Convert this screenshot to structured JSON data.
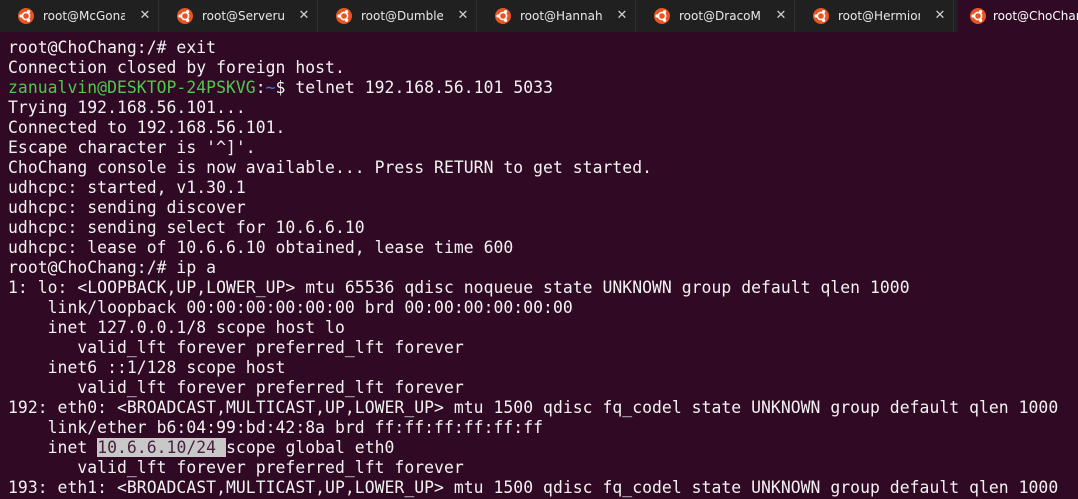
{
  "tabs": [
    {
      "title": "root@McGonag",
      "active": false
    },
    {
      "title": "root@Serverus!",
      "active": false
    },
    {
      "title": "root@Dumbled",
      "active": false
    },
    {
      "title": "root@HannahA",
      "active": false
    },
    {
      "title": "root@DracoMa",
      "active": false
    },
    {
      "title": "root@Hermionе",
      "active": false
    },
    {
      "title": "root@ChoChan",
      "active": true
    }
  ],
  "tab_close_glyph": "✕",
  "terminal": {
    "lines": [
      "root@ChoChang:/# exit",
      "Connection closed by foreign host.",
      {
        "user": "zanualvin@DESKTOP-24PSKVG",
        "sep": ":",
        "path": "~",
        "rest": "$ telnet 192.168.56.101 5033"
      },
      "Trying 192.168.56.101...",
      "Connected to 192.168.56.101.",
      "Escape character is '^]'.",
      "ChoChang console is now available... Press RETURN to get started.",
      "udhcpc: started, v1.30.1",
      "udhcpc: sending discover",
      "udhcpc: sending select for 10.6.6.10",
      "udhcpc: lease of 10.6.6.10 obtained, lease time 600",
      "root@ChoChang:/# ip a",
      "1: lo: <LOOPBACK,UP,LOWER_UP> mtu 65536 qdisc noqueue state UNKNOWN group default qlen 1000",
      "    link/loopback 00:00:00:00:00:00 brd 00:00:00:00:00:00",
      "    inet 127.0.0.1/8 scope host lo",
      "       valid_lft forever preferred_lft forever",
      "    inet6 ::1/128 scope host",
      "       valid_lft forever preferred_lft forever",
      "192: eth0: <BROADCAST,MULTICAST,UP,LOWER_UP> mtu 1500 qdisc fq_codel state UNKNOWN group default qlen 1000",
      "    link/ether b6:04:99:bd:42:8a brd ff:ff:ff:ff:ff:ff",
      {
        "before": "    inet ",
        "selected": "10.6.6.10/24 ",
        "after": "scope global eth0"
      },
      "       valid_lft forever preferred_lft forever",
      "193: eth1: <BROADCAST,MULTICAST,UP,LOWER_UP> mtu 1500 qdisc fq_codel state UNKNOWN group default qlen 1000"
    ]
  },
  "colors": {
    "terminal_bg": "#300a24",
    "tabbar_bg": "#202020",
    "prompt_user": "#4ec94e",
    "prompt_path": "#3b78ff",
    "ubuntu_orange": "#e95420"
  }
}
